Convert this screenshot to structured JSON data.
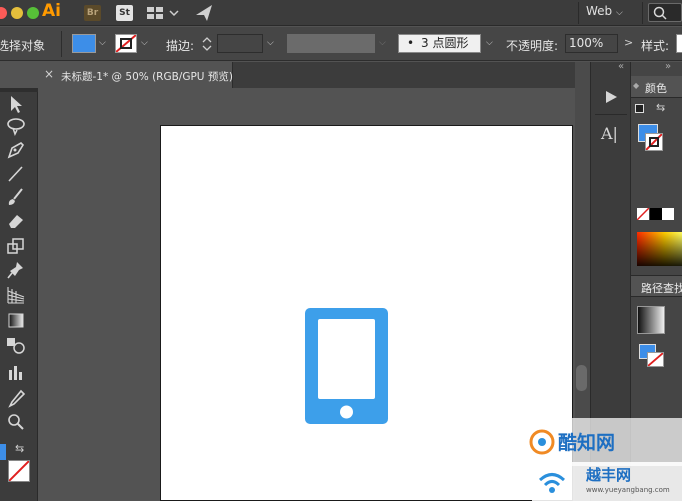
{
  "appbar": {
    "app_name": "Ai",
    "bridge_label": "Br",
    "stock_label": "St",
    "workspace": "Web",
    "window_controls": {
      "close": "#fc5b57",
      "minimize": "#e5bf3c",
      "zoom": "#57c038"
    },
    "icons": [
      "arrange-documents-icon",
      "send-icon",
      "search-icon"
    ]
  },
  "control_bar": {
    "selection_label": "选择对象",
    "fill_color": "#3d8ee8",
    "stroke_label": "描边:",
    "brush_label": "3 点圆形",
    "opacity_label": "不透明度:",
    "opacity_value": "100%",
    "style_label": "样式:"
  },
  "tab": {
    "title": "未标题-1* @ 50% (RGB/GPU 预览)",
    "close_glyph": "×"
  },
  "panels": {
    "color_tab": "颜色",
    "pathfinder_tab": "路径查找"
  },
  "artwork": {
    "phone_color": "#3d9fea"
  },
  "watermarks": {
    "line1": "酷知网",
    "line2": "越丰网",
    "line2_url": "www.yueyangbang.com"
  }
}
